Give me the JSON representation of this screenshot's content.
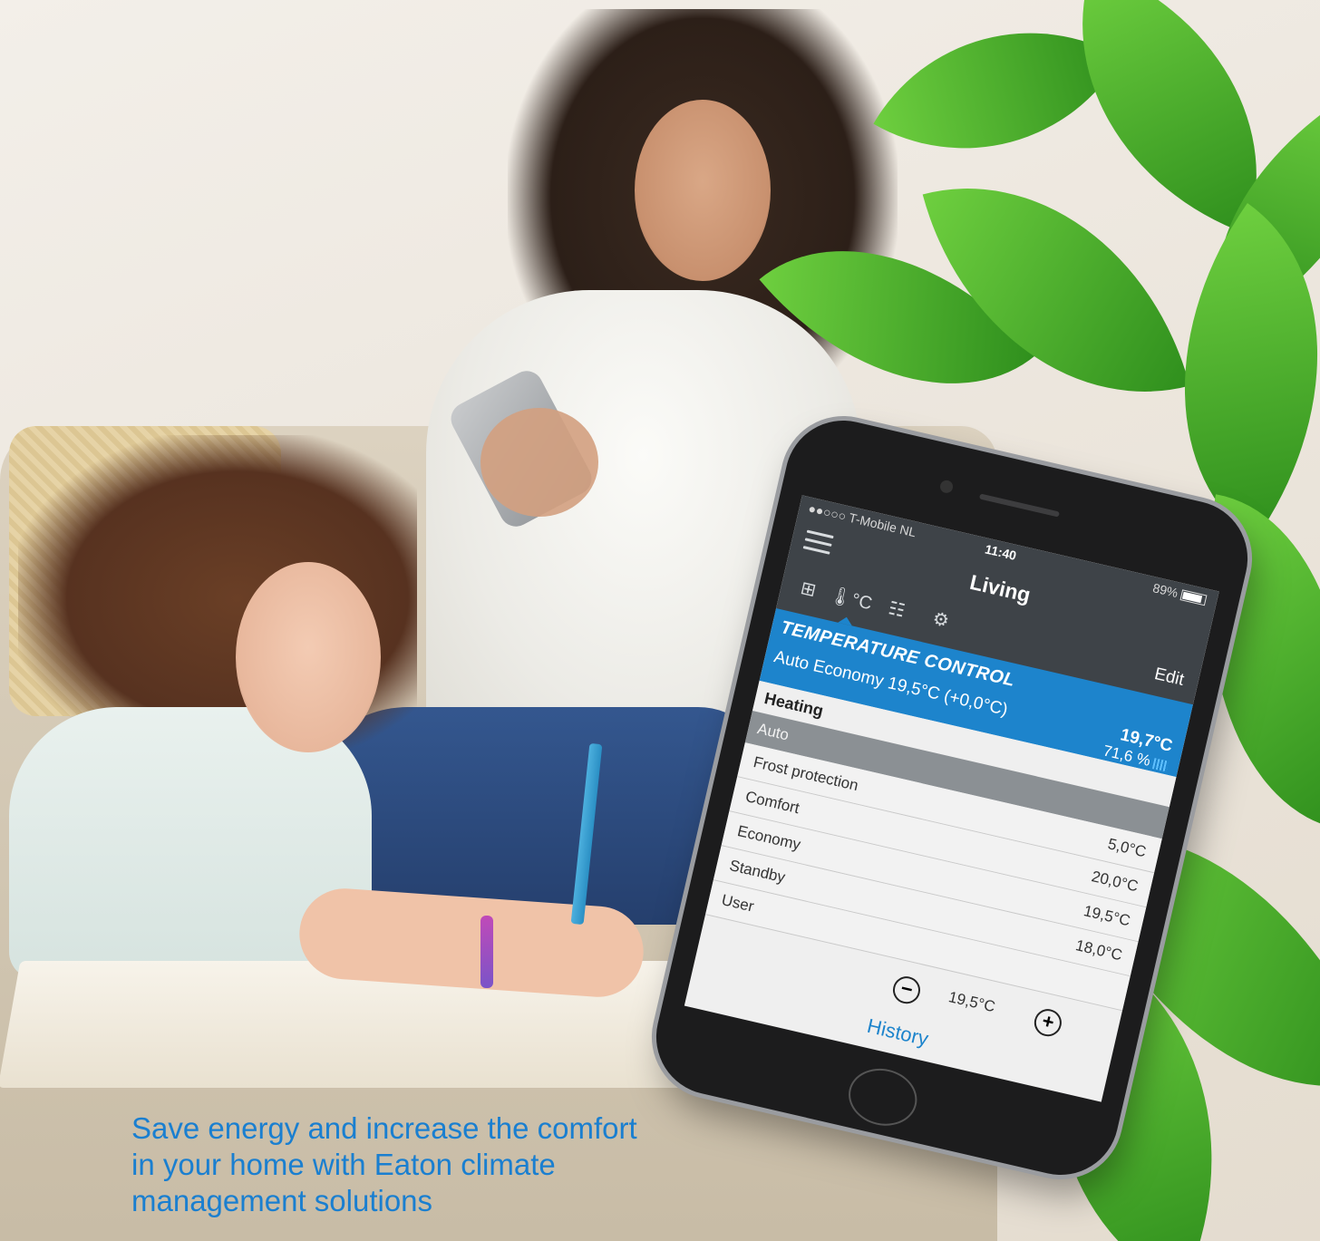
{
  "caption": "Save energy and increase the comfort in your home with Eaton climate management solutions",
  "phone": {
    "status": {
      "carrier": "●●○○○ T-Mobile NL",
      "time": "11:40",
      "battery": "89%"
    },
    "title": "Living",
    "edit_label": "Edit",
    "tabs": [
      {
        "name": "overview",
        "icon": "grid-icon",
        "glyph": "⊞"
      },
      {
        "name": "temperature",
        "icon": "thermometer-icon",
        "glyph": "🌡°C"
      },
      {
        "name": "controls",
        "icon": "sliders-icon",
        "glyph": "☷"
      },
      {
        "name": "settings",
        "icon": "gears-icon",
        "glyph": "⚙"
      }
    ],
    "panel": {
      "heading": "TEMPERATURE CONTROL",
      "mode": "Auto Economy 19,5°C (+0,0°C)",
      "current_temp": "19,7°C",
      "valve": "71,6 %"
    },
    "section_title": "Heating",
    "selected_mode": "Auto",
    "presets": [
      {
        "label": "Frost protection",
        "value": "5,0°C"
      },
      {
        "label": "Comfort",
        "value": "20,0°C"
      },
      {
        "label": "Economy",
        "value": "19,5°C"
      },
      {
        "label": "Standby",
        "value": "18,0°C"
      },
      {
        "label": "User",
        "value": ""
      }
    ],
    "stepper": {
      "minus": "−",
      "plus": "+",
      "value": "19,5°C"
    },
    "history_label": "History"
  },
  "colors": {
    "accent": "#1d84cc",
    "caption": "#1a7fd0",
    "topbar": "#3e4348"
  }
}
